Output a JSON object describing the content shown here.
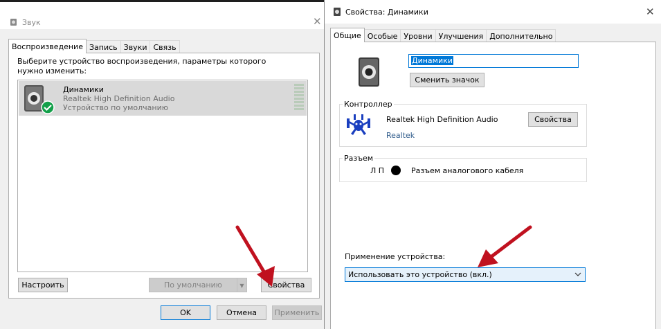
{
  "sound_window": {
    "title": "Звук",
    "tabs": [
      "Воспроизведение",
      "Запись",
      "Звуки",
      "Связь"
    ],
    "instruction": "Выберите устройство воспроизведения, параметры которого нужно изменить:",
    "device": {
      "name": "Динамики",
      "driver": "Realtek High Definition Audio",
      "status": "Устройство по умолчанию"
    },
    "buttons": {
      "configure": "Настроить",
      "set_default": "По умолчанию",
      "properties": "Свойства"
    },
    "footer": {
      "ok": "OK",
      "cancel": "Отмена",
      "apply": "Применить"
    }
  },
  "props_window": {
    "title": "Свойства: Динамики",
    "tabs": [
      "Общие",
      "Особые",
      "Уровни",
      "Улучшения",
      "Дополнительно"
    ],
    "device_name_value": "Динамики",
    "change_icon_button": "Сменить значок",
    "controller": {
      "label": "Контроллер",
      "name": "Realtek High Definition Audio",
      "vendor_link": "Realtek",
      "properties_button": "Свойства"
    },
    "jack": {
      "label": "Разъем",
      "channels": "Л П",
      "description": "Разъем аналогового кабеля"
    },
    "usage": {
      "label": "Применение устройства:",
      "selected": "Использовать это устройство (вкл.)"
    }
  },
  "colors": {
    "accent": "#0078d7",
    "selection": "#d9d9d9",
    "arrow": "#c0111f",
    "check_green": "#14a04a",
    "link": "#2d5a8a"
  }
}
